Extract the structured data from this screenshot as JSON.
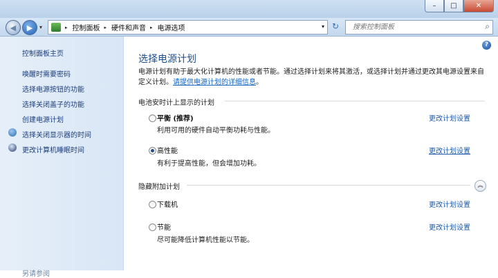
{
  "window": {
    "minimize": "–",
    "maximize": "□",
    "close": "✕"
  },
  "nav": {
    "back": "◀",
    "forward": "▶",
    "recent": "▾",
    "refresh": "↻"
  },
  "address": {
    "breadcrumbs": [
      "控制面板",
      "硬件和声音",
      "电源选项"
    ],
    "sep": "▸",
    "dropdown": "▾"
  },
  "search": {
    "placeholder": "搜索控制面板",
    "icon": "search-icon",
    "glyph": "⌕"
  },
  "sidebar": {
    "home": "控制面板主页",
    "items": [
      "唤醒时需要密码",
      "选择电源按钮的功能",
      "选择关闭盖子的功能",
      "创建电源计划",
      "选择关闭显示器的时间",
      "更改计算机睡眠时间"
    ],
    "see_also": "另请参阅"
  },
  "main": {
    "help": "?",
    "title": "选择电源计划",
    "desc": "电源计划有助于最大化计算机的性能或者节能。通过选择计划来将其激活，或选择计划并通过更改其电源设置来自定义计划。",
    "desc_link": "请提供电源计划的详细信息",
    "desc_end": "。",
    "battery_group": "电池安时计上显示的计划",
    "hidden_group": "隐藏附加计划",
    "collapse": "︽",
    "plans": [
      {
        "name": "平衡 (推荐)",
        "desc": "利用可用的硬件自动平衡功耗与性能。",
        "change": "更改计划设置",
        "selected": false
      },
      {
        "name": "高性能",
        "desc": "有利于提高性能，但会增加功耗。",
        "change": "更改计划设置",
        "selected": true
      },
      {
        "name": "下载机",
        "desc": "",
        "change": "更改计划设置",
        "selected": false
      },
      {
        "name": "节能",
        "desc": "尽可能降低计算机性能以节能。",
        "change": "更改计划设置",
        "selected": false
      }
    ]
  },
  "colors": {
    "accent": "#1b4e8f",
    "link": "#1565c0"
  }
}
